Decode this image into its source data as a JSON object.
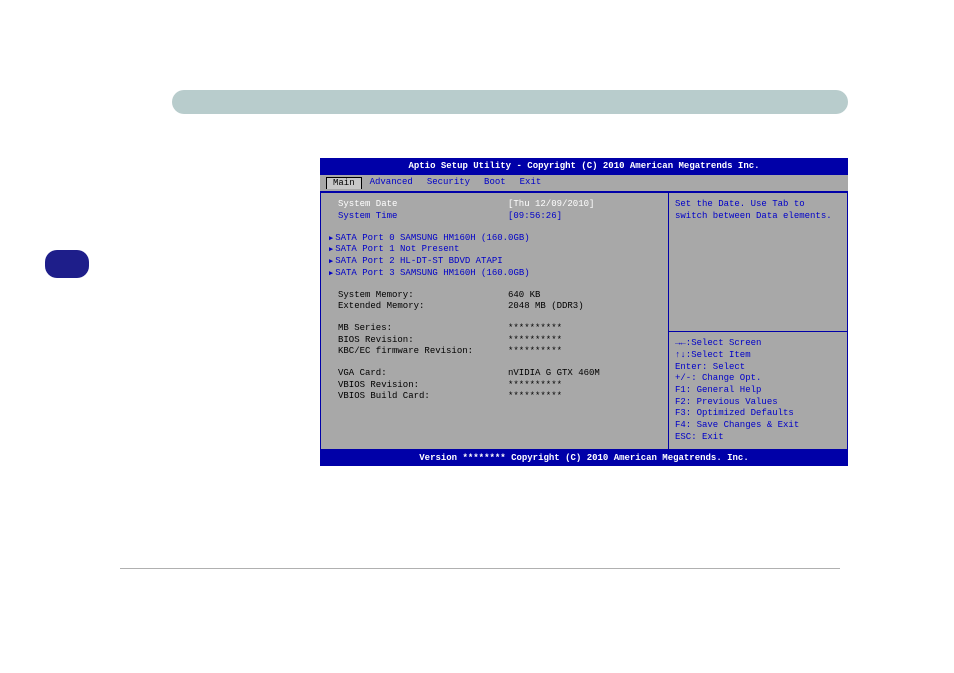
{
  "title": "Aptio Setup Utility - Copyright (C) 2010 American Megatrends Inc.",
  "tabs": [
    "Main",
    "Advanced",
    "Security",
    "Boot",
    "Exit"
  ],
  "main": {
    "systemDateLabel": "System Date",
    "systemDateValue": "[Thu 12/09/2010]",
    "systemTimeLabel": "System Time",
    "systemTimeValue": "[09:56:26]",
    "sata": [
      "SATA Port 0 SAMSUNG HM160H (160.0GB)",
      "SATA Port 1 Not Present",
      "SATA Port 2 HL-DT-ST BDVD ATAPI",
      "SATA Port 3 SAMSUNG HM160H (160.0GB)"
    ],
    "sysMemLabel": "System Memory:",
    "sysMemValue": "640 KB",
    "extMemLabel": "Extended Memory:",
    "extMemValue": "2048 MB (DDR3)",
    "mbLabel": "MB Series:",
    "mbValue": "**********",
    "biosRevLabel": "BIOS Revision:",
    "biosRevValue": "**********",
    "kbcLabel": "KBC/EC firmware Revision:",
    "kbcValue": "**********",
    "vgaLabel": "VGA Card:",
    "vgaValue": "nVIDIA G GTX 460M",
    "vbiosRevLabel": "VBIOS Revision:",
    "vbiosRevValue": "**********",
    "vbiosBuildLabel": "VBIOS Build Card:",
    "vbiosBuildValue": "**********"
  },
  "helpTop": [
    "Set the Date. Use Tab to",
    "switch between Data elements."
  ],
  "helpBottom": [
    "→←:Select Screen",
    "↑↓:Select Item",
    "Enter: Select",
    "+/-: Change Opt.",
    "F1: General Help",
    "F2: Previous Values",
    "F3: Optimized Defaults",
    "F4: Save Changes & Exit",
    "ESC: Exit"
  ],
  "footer": "Version ******** Copyright (C) 2010 American Megatrends. Inc."
}
